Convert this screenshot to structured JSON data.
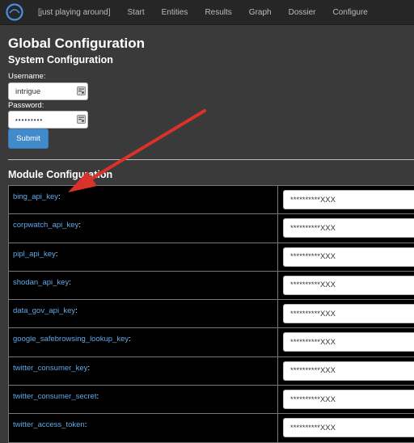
{
  "nav": {
    "items": [
      "[just playing around]",
      "Start",
      "Entities",
      "Results",
      "Graph",
      "Dossier",
      "Configure"
    ]
  },
  "page_title": "Global Configuration",
  "system": {
    "title": "System Configuration",
    "username_label": "Username:",
    "username_value": "intrigue",
    "password_label": "Password:",
    "password_value": "•••••••••",
    "submit_label": "Submit"
  },
  "module": {
    "title": "Module Configuration",
    "rows": [
      {
        "key": "bing_api_key",
        "value": "**********XXX"
      },
      {
        "key": "corpwatch_api_key",
        "value": "**********XXX"
      },
      {
        "key": "pipl_api_key",
        "value": "**********XXX"
      },
      {
        "key": "shodan_api_key",
        "value": "**********XXX"
      },
      {
        "key": "data_gov_api_key",
        "value": "**********XXX"
      },
      {
        "key": "google_safebrowsing_lookup_key",
        "value": "**********XXX"
      },
      {
        "key": "twitter_consumer_key",
        "value": "**********XXX"
      },
      {
        "key": "twitter_consumer_secret",
        "value": "**********XXX"
      },
      {
        "key": "twitter_access_token",
        "value": "**********XXX"
      }
    ]
  },
  "colors": {
    "navbar": "#262626",
    "background": "#3a3a3a",
    "link": "#5fa9e8",
    "button": "#428bca",
    "arrow": "#d9322a"
  }
}
